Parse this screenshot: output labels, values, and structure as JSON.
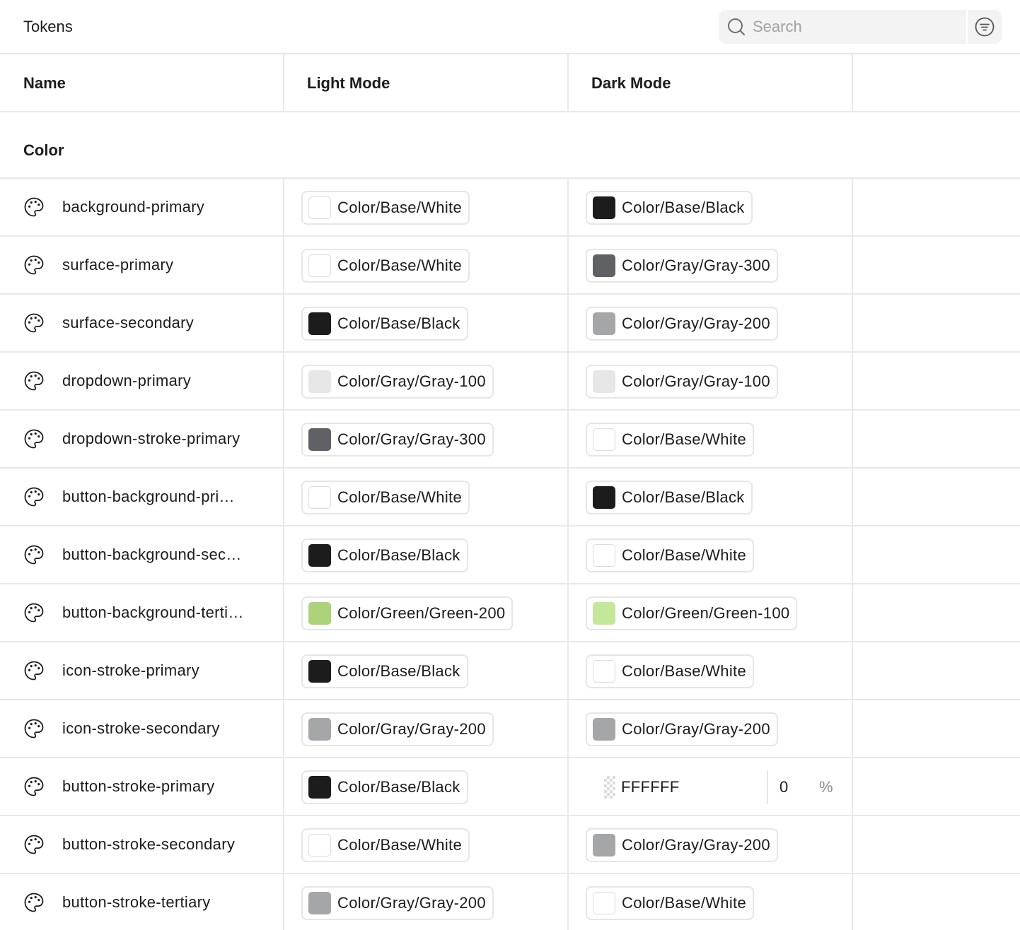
{
  "header": {
    "title": "Tokens",
    "search_placeholder": "Search"
  },
  "table": {
    "columns": [
      "Name",
      "Light Mode",
      "Dark Mode"
    ],
    "group": "Color",
    "rows": [
      {
        "name": "background-primary",
        "light": {
          "label": "Color/Base/White",
          "swatch": "#ffffff"
        },
        "dark": {
          "label": "Color/Base/Black",
          "swatch": "#1c1c1c"
        }
      },
      {
        "name": "surface-primary",
        "light": {
          "label": "Color/Base/White",
          "swatch": "#ffffff"
        },
        "dark": {
          "label": "Color/Gray/Gray-300",
          "swatch": "#5f6164"
        }
      },
      {
        "name": "surface-secondary",
        "light": {
          "label": "Color/Base/Black",
          "swatch": "#1c1c1c"
        },
        "dark": {
          "label": "Color/Gray/Gray-200",
          "swatch": "#a4a6a8"
        }
      },
      {
        "name": "dropdown-primary",
        "light": {
          "label": "Color/Gray/Gray-100",
          "swatch": "#e6e6e6"
        },
        "dark": {
          "label": "Color/Gray/Gray-100",
          "swatch": "#e6e6e6"
        }
      },
      {
        "name": "dropdown-stroke-primary",
        "light": {
          "label": "Color/Gray/Gray-300",
          "swatch": "#5f6164"
        },
        "dark": {
          "label": "Color/Base/White",
          "swatch": "#ffffff"
        }
      },
      {
        "name": "button-background-pri…",
        "light": {
          "label": "Color/Base/White",
          "swatch": "#ffffff"
        },
        "dark": {
          "label": "Color/Base/Black",
          "swatch": "#1c1c1c"
        }
      },
      {
        "name": "button-background-sec…",
        "light": {
          "label": "Color/Base/Black",
          "swatch": "#1c1c1c"
        },
        "dark": {
          "label": "Color/Base/White",
          "swatch": "#ffffff"
        }
      },
      {
        "name": "button-background-terti…",
        "light": {
          "label": "Color/Green/Green-200",
          "swatch": "#acd27c"
        },
        "dark": {
          "label": "Color/Green/Green-100",
          "swatch": "#c4e799"
        }
      },
      {
        "name": "icon-stroke-primary",
        "light": {
          "label": "Color/Base/Black",
          "swatch": "#1c1c1c"
        },
        "dark": {
          "label": "Color/Base/White",
          "swatch": "#ffffff"
        }
      },
      {
        "name": "icon-stroke-secondary",
        "light": {
          "label": "Color/Gray/Gray-200",
          "swatch": "#a4a6a8"
        },
        "dark": {
          "label": "Color/Gray/Gray-200",
          "swatch": "#a4a6a8"
        }
      },
      {
        "name": "button-stroke-primary",
        "light": {
          "label": "Color/Base/Black",
          "swatch": "#1c1c1c"
        },
        "dark": {
          "raw": true,
          "hex": "FFFFFF",
          "opacity": "0",
          "unit": "%"
        }
      },
      {
        "name": "button-stroke-secondary",
        "light": {
          "label": "Color/Base/White",
          "swatch": "#ffffff"
        },
        "dark": {
          "label": "Color/Gray/Gray-200",
          "swatch": "#a4a6a8"
        }
      },
      {
        "name": "button-stroke-tertiary",
        "light": {
          "label": "Color/Gray/Gray-200",
          "swatch": "#a4a6a8"
        },
        "dark": {
          "label": "Color/Base/White",
          "swatch": "#ffffff"
        }
      }
    ]
  },
  "icons": {
    "search": "search-icon",
    "filter": "filter-icon",
    "row": "palette-icon"
  },
  "colors": {
    "border": "#e8e8e8",
    "search_bg": "#f3f3f3",
    "text": "#1c1c1c"
  }
}
